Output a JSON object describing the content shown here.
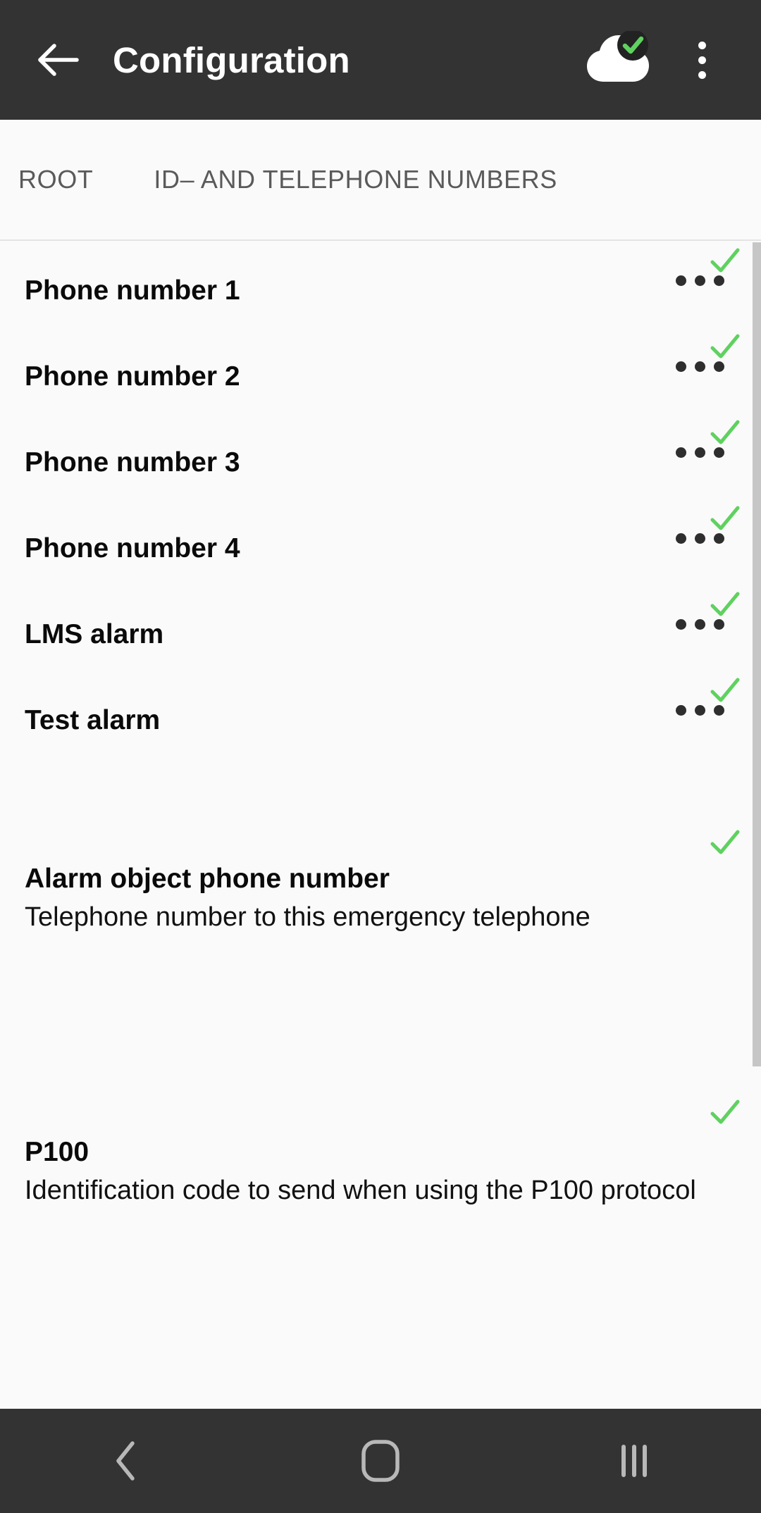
{
  "appbar": {
    "back_icon": "arrow-left-icon",
    "title": "Configuration",
    "cloud_icon": "cloud-synced-icon",
    "overflow_icon": "more-vertical-icon"
  },
  "breadcrumb": {
    "root_label": "ROOT",
    "current_label": "ID– AND TELEPHONE NUMBERS"
  },
  "list": {
    "rows": [
      {
        "title": "Phone number 1",
        "desc": "",
        "has_menu": true,
        "has_check": true
      },
      {
        "title": "Phone number 2",
        "desc": "",
        "has_menu": true,
        "has_check": true
      },
      {
        "title": "Phone number 3",
        "desc": "",
        "has_menu": true,
        "has_check": true
      },
      {
        "title": "Phone number 4",
        "desc": "",
        "has_menu": true,
        "has_check": true
      },
      {
        "title": "LMS alarm",
        "desc": "",
        "has_menu": true,
        "has_check": true
      },
      {
        "title": "Test alarm",
        "desc": "",
        "has_menu": true,
        "has_check": true
      },
      {
        "title": "Alarm object phone number",
        "desc": "Telephone number to this emergency telephone",
        "has_menu": false,
        "has_check": true
      },
      {
        "title": "P100",
        "desc": "Identification code to send when using the P100 protocol",
        "has_menu": false,
        "has_check": true
      }
    ]
  },
  "navbar": {
    "back_label": "back-icon",
    "home_label": "home-icon",
    "recents_label": "recents-icon"
  },
  "colors": {
    "appbar_bg": "#333333",
    "page_bg": "#fafafa",
    "check_green": "#5fd15f",
    "scrollbar": "#c6c6c6",
    "breadcrumb_text": "#5a5a5a"
  }
}
